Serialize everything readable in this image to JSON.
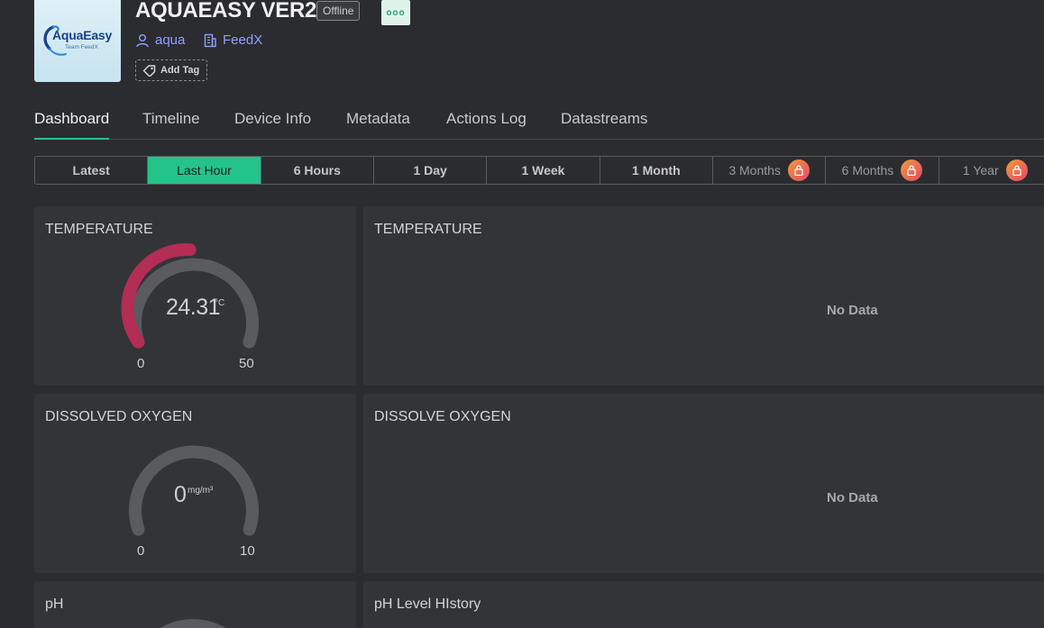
{
  "header": {
    "logo": {
      "name": "AquaEasy",
      "sub": "Team FeedX"
    },
    "title": "AQUAEASY VER2",
    "status": "Offline",
    "more_icon": "ellipsis-icon",
    "owner": "aqua",
    "organization": "FeedX",
    "add_tag": "Add Tag"
  },
  "tabs": [
    {
      "label": "Dashboard"
    },
    {
      "label": "Timeline"
    },
    {
      "label": "Device Info"
    },
    {
      "label": "Metadata"
    },
    {
      "label": "Actions Log"
    },
    {
      "label": "Datastreams"
    }
  ],
  "ranges": [
    {
      "label": "Latest"
    },
    {
      "label": "Last Hour"
    },
    {
      "label": "6 Hours"
    },
    {
      "label": "1 Day"
    },
    {
      "label": "1 Week"
    },
    {
      "label": "1 Month"
    },
    {
      "label": "3 Months"
    },
    {
      "label": "6 Months"
    },
    {
      "label": "1 Year"
    }
  ],
  "colors": {
    "accent": "#22c48a",
    "gauge_fill": "#b32d55",
    "gauge_track": "#5a5b5e",
    "link": "#8ea0ff"
  },
  "widgets": {
    "temperature_gauge": {
      "title": "TEMPERATURE",
      "value": "24.31",
      "unit": "°C",
      "min": "0",
      "max": "50"
    },
    "temperature_chart": {
      "title": "TEMPERATURE",
      "empty": "No Data"
    },
    "oxygen_gauge": {
      "title": "DISSOLVED OXYGEN",
      "value": "0",
      "unit": "mg/m³",
      "min": "0",
      "max": "10"
    },
    "oxygen_chart": {
      "title": "DISSOLVE OXYGEN",
      "empty": "No Data"
    },
    "ph_gauge": {
      "title": "pH"
    },
    "ph_chart": {
      "title": "pH Level HIstory"
    }
  }
}
